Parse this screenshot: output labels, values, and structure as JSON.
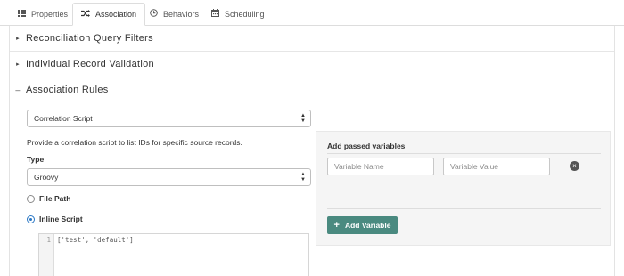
{
  "tabs": [
    {
      "label": "Properties",
      "icon": "list-icon",
      "active": false
    },
    {
      "label": "Association",
      "icon": "shuffle-icon",
      "active": true
    },
    {
      "label": "Behaviors",
      "icon": "clock-icon",
      "active": false
    },
    {
      "label": "Scheduling",
      "icon": "calendar-icon",
      "active": false
    }
  ],
  "sections": {
    "reconciliation": {
      "title": "Reconciliation Query Filters",
      "expanded": false
    },
    "validation": {
      "title": "Individual Record Validation",
      "expanded": false
    },
    "association": {
      "title": "Association Rules",
      "expanded": true
    }
  },
  "association": {
    "rule_select_value": "Correlation Script",
    "description": "Provide a correlation script to list IDs for specific source records.",
    "type_label": "Type",
    "type_select_value": "Groovy",
    "file_path_label": "File Path",
    "inline_script_label": "Inline Script",
    "selected_source": "inline",
    "editor": {
      "line_number": "1",
      "code": "['test', 'default']"
    }
  },
  "variables": {
    "title": "Add passed variables",
    "name_placeholder": "Variable Name",
    "value_placeholder": "Variable Value",
    "add_button_label": "Add Variable"
  },
  "colors": {
    "accent": "#4a8a80",
    "radio": "#2b78c5",
    "card_bg": "#f5f5f5"
  }
}
